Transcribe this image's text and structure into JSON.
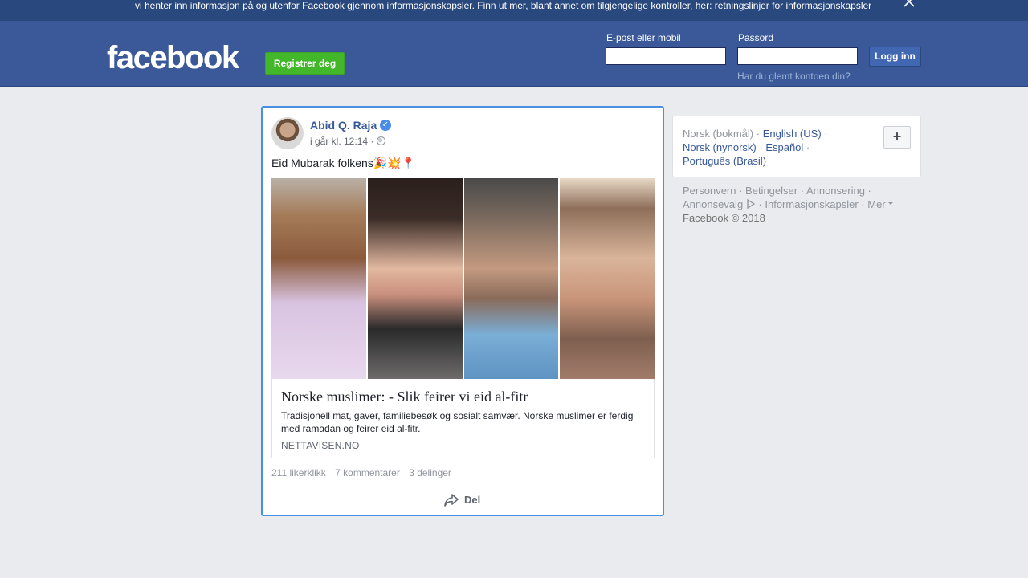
{
  "cookie_banner": {
    "text": "vi henter inn informasjon på og utenfor Facebook gjennom informasjonskapsler. Finn ut mer, blant annet om tilgjengelige kontroller, her: ",
    "link": "retningslinjer for informasjonskapsler"
  },
  "header": {
    "logo": "facebook",
    "register_label": "Registrer deg",
    "email_label": "E-post eller mobil",
    "email_value": "",
    "password_label": "Passord",
    "password_value": "",
    "login_label": "Logg inn",
    "forgot_link": "Har du glemt kontoen din?"
  },
  "post": {
    "author": "Abid Q. Raja",
    "verified_mark": "✓",
    "timestamp": "i går kl. 12:14 ·",
    "text": "Eid Mubarak folkens🎉💥📍",
    "link_preview": {
      "title": "Norske muslimer: - Slik feirer vi eid al-fitr",
      "description": "Tradisjonell mat, gaver, familiebesøk og sosialt samvær. Norske muslimer er ferdig med ramadan og feirer eid al-fitr.",
      "domain": "NETTAVISEN.NO"
    },
    "stats": {
      "likes": "211 likerklikk",
      "comments": "7 kommentarer",
      "shares": "3 delinger"
    },
    "share_label": "Del"
  },
  "languages": {
    "current": "Norsk (bokmål)",
    "items": [
      "English (US)",
      "Norsk (nynorsk)",
      "Español",
      "Português (Brasil)"
    ],
    "add_label": "+"
  },
  "footer": {
    "links": [
      "Personvern",
      "Betingelser",
      "Annonsering",
      "Annonsevalg",
      "Informasjonskapsler",
      "Mer"
    ],
    "copyright": "Facebook © 2018"
  },
  "colors": {
    "brand_blue": "#3b5998",
    "register_green": "#42b72a",
    "link_blue": "#365899",
    "highlight_border": "#4a90e2"
  },
  "icons": [
    "close-icon",
    "verified-badge-icon",
    "globe-icon",
    "share-arrow-icon",
    "ad-choices-icon",
    "dropdown-caret-icon"
  ]
}
